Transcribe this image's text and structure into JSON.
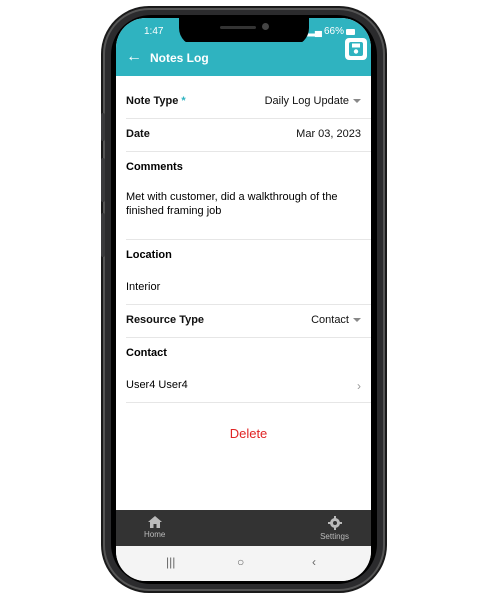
{
  "status": {
    "time": "1:47",
    "battery": "66%"
  },
  "appbar": {
    "title": "Notes Log"
  },
  "form": {
    "note_type": {
      "label": "Note Type",
      "required_mark": "*",
      "value": "Daily Log Update"
    },
    "date": {
      "label": "Date",
      "value": "Mar 03, 2023"
    },
    "comments": {
      "label": "Comments",
      "text": "Met with customer, did a walkthrough of the finished framing job"
    },
    "location": {
      "label": "Location",
      "value": "Interior"
    },
    "resource_type": {
      "label": "Resource Type",
      "value": "Contact"
    },
    "contact": {
      "label": "Contact",
      "value": "User4 User4"
    }
  },
  "actions": {
    "delete_label": "Delete"
  },
  "bottom_nav": {
    "home_label": "Home",
    "settings_label": "Settings"
  },
  "colors": {
    "accent": "#2fb3c0",
    "delete": "#e02424",
    "nav_bg": "#333333"
  }
}
